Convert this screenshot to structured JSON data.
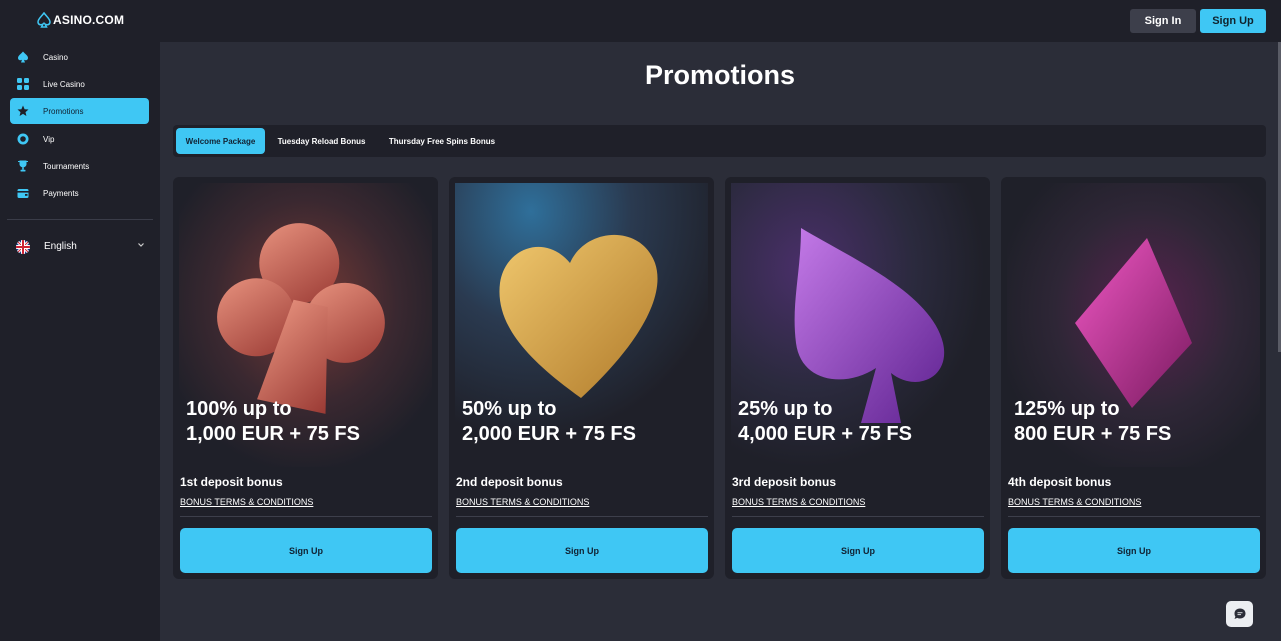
{
  "brand": {
    "logo_text": "ASINO.COM"
  },
  "header": {
    "sign_in_label": "Sign In",
    "sign_up_label": "Sign Up"
  },
  "sidebar": {
    "items": [
      {
        "label": "Casino",
        "icon": "spade-icon"
      },
      {
        "label": "Live Casino",
        "icon": "grid-icon"
      },
      {
        "label": "Promotions",
        "icon": "star-icon",
        "active": true
      },
      {
        "label": "Vip",
        "icon": "vip-icon"
      },
      {
        "label": "Tournaments",
        "icon": "trophy-icon"
      },
      {
        "label": "Payments",
        "icon": "wallet-icon"
      }
    ],
    "language": {
      "label": "English",
      "icon": "uk-flag-icon"
    }
  },
  "page": {
    "title": "Promotions"
  },
  "tabs": [
    {
      "label": "Welcome Package",
      "active": true
    },
    {
      "label": "Tuesday Reload Bonus"
    },
    {
      "label": "Thursday Free Spins Bonus"
    }
  ],
  "cards": [
    {
      "line1": "100% up to",
      "line2": "1,000 EUR + 75 FS",
      "subtitle": "1st deposit bonus",
      "terms": "BONUS TERMS & CONDITIONS",
      "button": "Sign Up",
      "art": "club-icon",
      "art_color": "#c0564a"
    },
    {
      "line1": "50% up to",
      "line2": "2,000 EUR + 75 FS",
      "subtitle": "2nd deposit bonus",
      "terms": "BONUS TERMS & CONDITIONS",
      "button": "Sign Up",
      "art": "heart-icon",
      "art_color": "#d9a53f"
    },
    {
      "line1": "25% up to",
      "line2": "4,000 EUR + 75 FS",
      "subtitle": "3rd deposit bonus",
      "terms": "BONUS TERMS & CONDITIONS",
      "button": "Sign Up",
      "art": "spade-icon",
      "art_color": "#9b45c9"
    },
    {
      "line1": "125% up to",
      "line2": "800 EUR + 75 FS",
      "subtitle": "4th deposit bonus",
      "terms": "BONUS TERMS & CONDITIONS",
      "button": "Sign Up",
      "art": "diamond-icon",
      "art_color": "#c0309a"
    }
  ],
  "colors": {
    "accent": "#3fc7f4",
    "background": "#2b2d38",
    "panel": "#1f2029"
  }
}
